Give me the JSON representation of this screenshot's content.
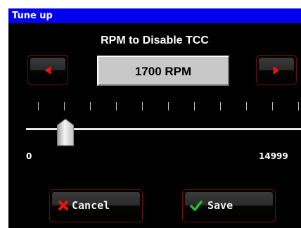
{
  "window": {
    "title": "Tune up"
  },
  "setting": {
    "name": "RPM to Disable TCC",
    "value_display": "1700 RPM",
    "value": 1700,
    "min": 0,
    "max": 14999,
    "min_label": "0",
    "max_label": "14999"
  },
  "icons": {
    "decrease": "left-arrow-icon",
    "increase": "right-arrow-icon",
    "cancel": "x-icon",
    "save": "checkmark-icon"
  },
  "buttons": {
    "cancel_label": "Cancel",
    "save_label": "Save"
  },
  "colors": {
    "titlebar": "#0000ee",
    "arrow": "#ee1111",
    "cancel_icon": "#ee1111",
    "save_icon": "#22c322",
    "button_border": "#6e1010"
  }
}
